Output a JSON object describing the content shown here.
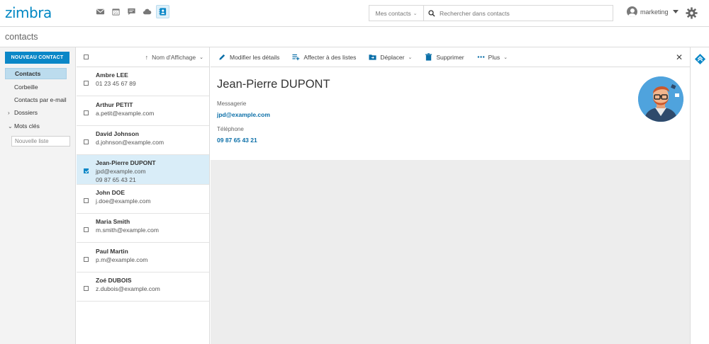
{
  "header": {
    "logo": "zimbra",
    "app_icons": [
      "mail-icon",
      "calendar-icon",
      "chat-icon",
      "cloud-icon",
      "contacts-icon"
    ],
    "search_scope": "Mes contacts",
    "search_placeholder": "Rechercher dans contacts",
    "user": "marketing"
  },
  "page_title": "contacts",
  "sidebar": {
    "new_button": "NOUVEAU CONTACT",
    "items": [
      {
        "label": "Contacts",
        "selected": true
      },
      {
        "label": "Corbeille"
      },
      {
        "label": "Contacts par e-mail"
      },
      {
        "label": "Dossiers",
        "expandable": true
      },
      {
        "label": "Mots clés",
        "expanded": true
      }
    ],
    "new_list_placeholder": "Nouvelle liste"
  },
  "list": {
    "sort_label": "Nom d'Affichage",
    "contacts": [
      {
        "name": "Ambre LEE",
        "sub": "01 23 45 67 89"
      },
      {
        "name": "Arthur PETIT",
        "sub": "a.petit@example.com"
      },
      {
        "name": "David Johnson",
        "sub": "d.johnson@example.com"
      },
      {
        "name": "Jean-Pierre DUPONT",
        "sub": "jpd@example.com",
        "sub2": "09 87 65 43 21",
        "selected": true
      },
      {
        "name": "John DOE",
        "sub": "j.doe@example.com"
      },
      {
        "name": "Maria Smith",
        "sub": "m.smith@example.com"
      },
      {
        "name": "Paul Martin",
        "sub": "p.m@example.com"
      },
      {
        "name": "Zoé DUBOIS",
        "sub": "z.dubois@example.com"
      }
    ]
  },
  "toolbar": {
    "edit": "Modifier les détails",
    "assign": "Affecter à des listes",
    "move": "Déplacer",
    "delete": "Supprimer",
    "more": "Plus"
  },
  "detail": {
    "name": "Jean-Pierre DUPONT",
    "email_label": "Messagerie",
    "email": "jpd@example.com",
    "phone_label": "Téléphone",
    "phone": "09 87 65 43 21"
  },
  "colors": {
    "brand": "#0087c3",
    "button": "#0b87c7",
    "selection": "#d9edf8",
    "link": "#0b6fa8"
  }
}
